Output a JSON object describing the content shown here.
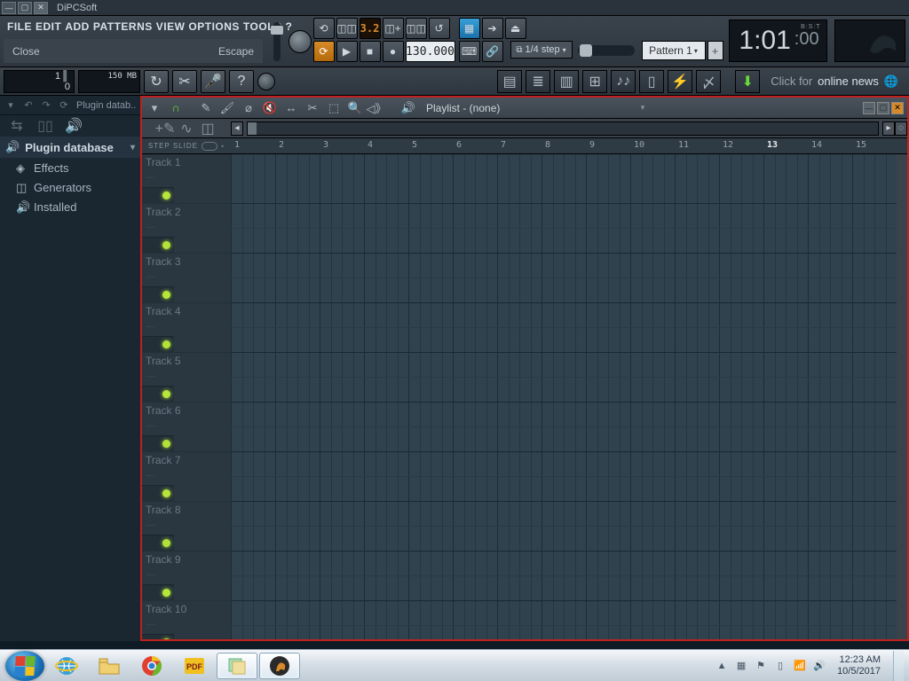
{
  "titlebar": {
    "app": "DiPCSoft"
  },
  "menu": {
    "file": "FILE",
    "edit": "EDIT",
    "add": "ADD",
    "patterns": "PATTERNS",
    "view": "VIEW",
    "options": "OPTIONS",
    "tools": "TOOLS",
    "help": "?"
  },
  "hint": {
    "left": "Close",
    "right": "Escape"
  },
  "transport": {
    "signature_lcd": "3.2",
    "tempo": "130.000"
  },
  "time": {
    "bst": "B:S:T",
    "main": "1:01",
    "ms": ":00"
  },
  "snap": {
    "value": "1/4 step"
  },
  "pattern": {
    "name": "Pattern 1"
  },
  "stats": {
    "proc": "1",
    "procpct": "0",
    "mem": "150 MB"
  },
  "news": {
    "prefix": "Click for ",
    "highlight": "online news"
  },
  "browser": {
    "title": "Plugin datab..",
    "root": "Plugin database",
    "items": [
      {
        "label": "Effects",
        "icon": "fx"
      },
      {
        "label": "Generators",
        "icon": "gen"
      },
      {
        "label": "Installed",
        "icon": "inst"
      }
    ]
  },
  "playlist": {
    "title": "Playlist - (none)",
    "stepslide": "STEP         SLIDE",
    "ruler": [
      1,
      2,
      3,
      4,
      5,
      6,
      7,
      8,
      9,
      10,
      11,
      12,
      13,
      14,
      15
    ],
    "ruler_highlight": 13,
    "tracks": [
      "Track 1",
      "Track 2",
      "Track 3",
      "Track 4",
      "Track 5",
      "Track 6",
      "Track 7",
      "Track 8",
      "Track 9",
      "Track 10"
    ]
  },
  "taskbar": {
    "time": "12:23 AM",
    "date": "10/5/2017"
  }
}
